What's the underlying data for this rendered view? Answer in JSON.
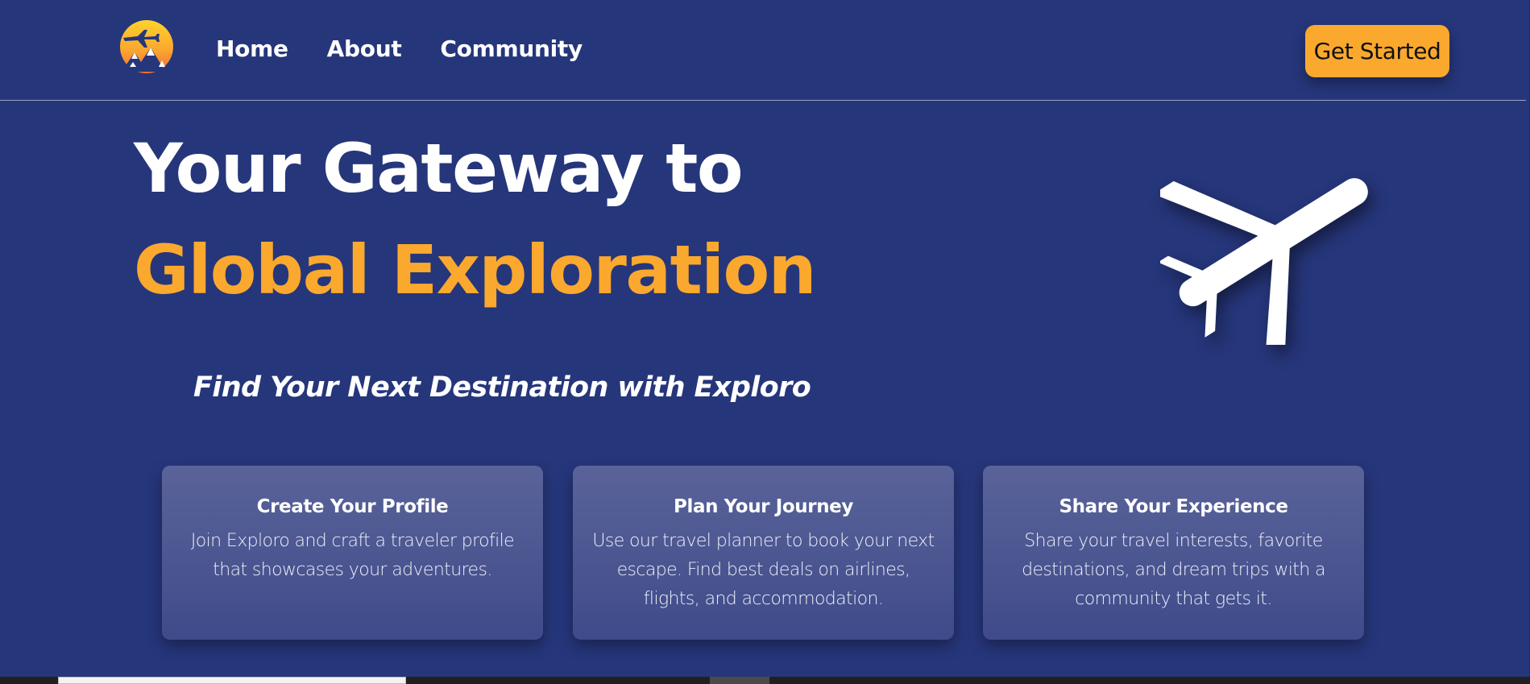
{
  "nav": {
    "links": [
      {
        "label": "Home"
      },
      {
        "label": "About"
      },
      {
        "label": "Community"
      }
    ],
    "cta_label": "Get Started"
  },
  "hero": {
    "title_line1": "Your Gateway to",
    "title_line2": "Global Exploration",
    "tagline": "Find Your Next Destination with Exploro"
  },
  "cards": [
    {
      "title": "Create Your Profile",
      "text": "Join Exploro and craft a traveler profile that showcases your adventures."
    },
    {
      "title": "Plan Your Journey",
      "text": "Use our travel planner to book your next escape. Find best deals on airlines, flights, and accommodation."
    },
    {
      "title": "Share Your Experience",
      "text": "Share your travel interests, favorite destinations, and dream trips with a community that gets it."
    }
  ],
  "icons": {
    "logo": "sunset-airplane-mountains-logo",
    "hero": "airplane-icon"
  },
  "colors": {
    "background": "#26367b",
    "accent": "#fba82e",
    "card_top": "#5a6399",
    "card_bottom": "#3f4b8a",
    "text": "#ffffff"
  }
}
